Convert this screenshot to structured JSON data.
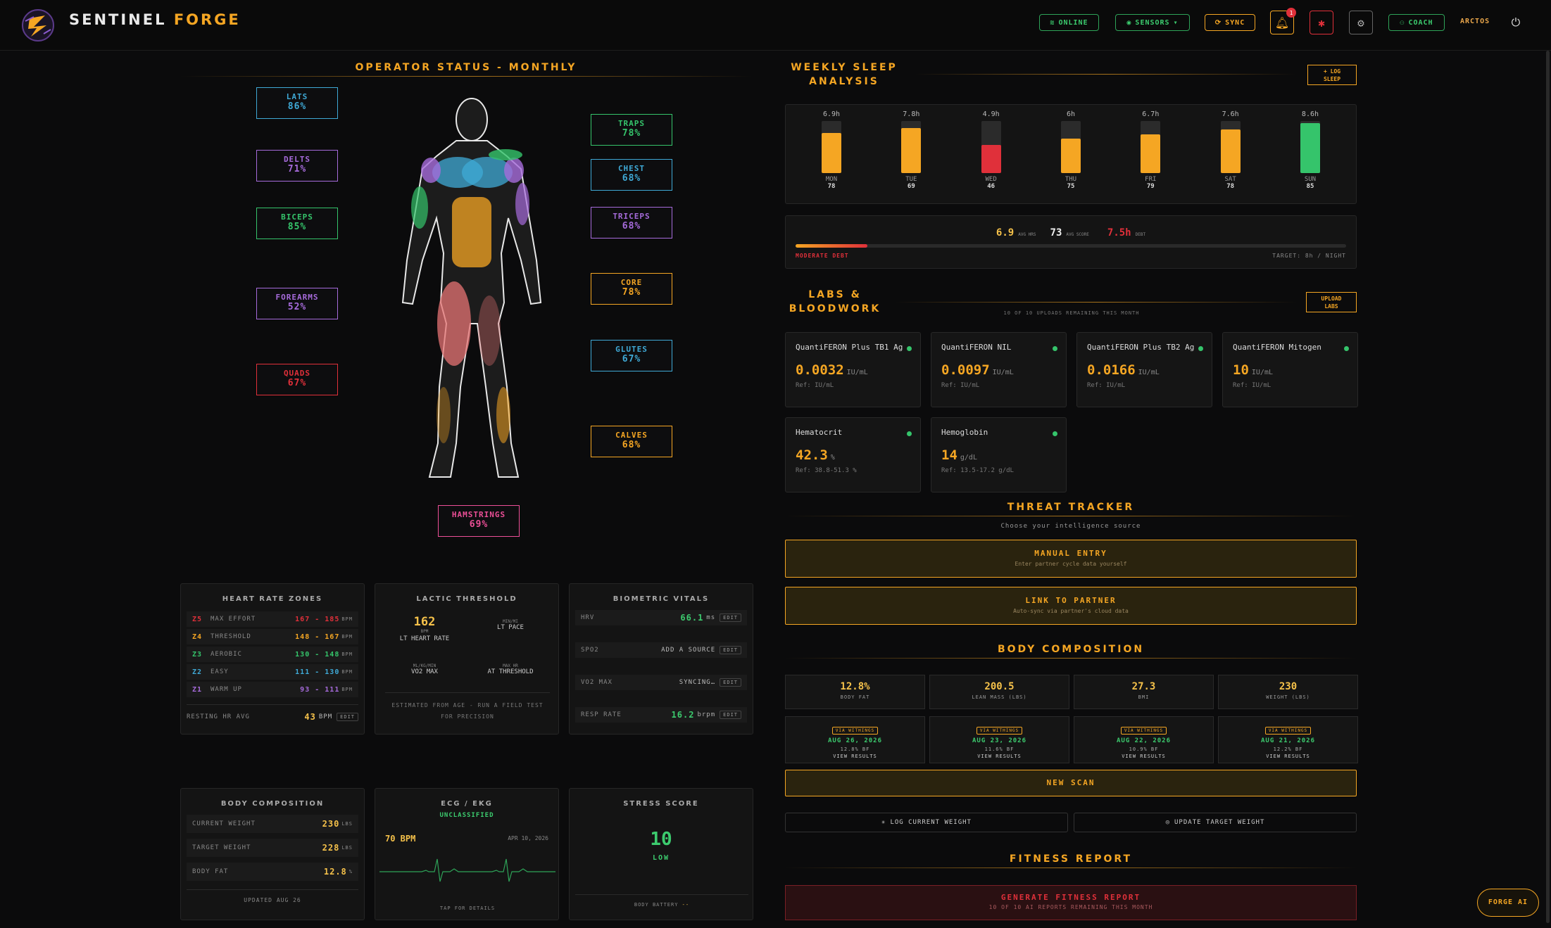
{
  "header": {
    "brand_main": "SENTINEL",
    "brand_accent": "FORGE",
    "online": "ONLINE",
    "sensors": "SENSORS",
    "sync": "SYNC",
    "notif_count": "1",
    "coach": "COACH",
    "user": "ARCTOS"
  },
  "operator": {
    "title": "OPERATOR STATUS - MONTHLY",
    "muscles": [
      {
        "name": "LATS",
        "pct": "86%",
        "color": "#3fa9d6"
      },
      {
        "name": "DELTS",
        "pct": "71%",
        "color": "#a66bdb"
      },
      {
        "name": "BICEPS",
        "pct": "85%",
        "color": "#35c46b"
      },
      {
        "name": "FOREARMS",
        "pct": "52%",
        "color": "#a66bdb"
      },
      {
        "name": "QUADS",
        "pct": "67%",
        "color": "#e0303a"
      },
      {
        "name": "TRAPS",
        "pct": "78%",
        "color": "#35c46b"
      },
      {
        "name": "CHEST",
        "pct": "68%",
        "color": "#3fa9d6"
      },
      {
        "name": "TRICEPS",
        "pct": "68%",
        "color": "#a66bdb"
      },
      {
        "name": "CORE",
        "pct": "78%",
        "color": "#f5a623"
      },
      {
        "name": "GLUTES",
        "pct": "67%",
        "color": "#3fa9d6"
      },
      {
        "name": "CALVES",
        "pct": "68%",
        "color": "#f5a623"
      },
      {
        "name": "HAMSTRINGS",
        "pct": "69%",
        "color": "#ec4f97"
      }
    ]
  },
  "hrz": {
    "title": "HEART RATE ZONES",
    "zones": [
      {
        "z": "Z5",
        "name": "MAX EFFORT",
        "range": "167 - 185",
        "unit": "BPM",
        "color": "#e0303a"
      },
      {
        "z": "Z4",
        "name": "THRESHOLD",
        "range": "148 - 167",
        "unit": "BPM",
        "color": "#f5a623"
      },
      {
        "z": "Z3",
        "name": "AEROBIC",
        "range": "130 - 148",
        "unit": "BPM",
        "color": "#35c46b"
      },
      {
        "z": "Z2",
        "name": "EASY",
        "range": "111 - 130",
        "unit": "BPM",
        "color": "#3fa9d6"
      },
      {
        "z": "Z1",
        "name": "WARM UP",
        "range": "93 - 111",
        "unit": "BPM",
        "color": "#a66bdb"
      }
    ],
    "resting_label": "RESTING HR AVG",
    "resting_val": "43",
    "resting_unit": "BPM",
    "edit": "EDIT"
  },
  "lactic": {
    "title": "LACTIC THRESHOLD",
    "hr": "162",
    "hr_unit": "BPM",
    "hr_label": "LT HEART RATE",
    "pace_unit": "MIN/MI",
    "pace_label": "LT PACE",
    "vo2_unit": "ML/KG/MIN",
    "vo2_label": "VO2 MAX",
    "maxhr_unit": "MAX HR",
    "maxhr_label": "AT THRESHOLD",
    "note": "ESTIMATED FROM AGE - RUN A FIELD TEST FOR PRECISION"
  },
  "bio": {
    "title": "BIOMETRIC VITALS",
    "rows": [
      {
        "k": "HRV",
        "v": "66.1",
        "u": "ms"
      },
      {
        "k": "SPO2",
        "v": "ADD A SOURCE",
        "u": ""
      },
      {
        "k": "VO2 MAX",
        "v": "SYNCING…",
        "u": ""
      },
      {
        "k": "RESP RATE",
        "v": "16.2",
        "u": "brpm"
      }
    ]
  },
  "bodycomp_left": {
    "title": "BODY COMPOSITION",
    "rows": [
      {
        "k": "CURRENT WEIGHT",
        "v": "230",
        "u": "LBS"
      },
      {
        "k": "TARGET WEIGHT",
        "v": "228",
        "u": "LBS"
      },
      {
        "k": "BODY FAT",
        "v": "12.8",
        "u": "%"
      }
    ],
    "updated": "UPDATED AUG 26"
  },
  "ecg": {
    "title": "ECG / EKG",
    "status": "UNCLASSIFIED",
    "bpm": "70 BPM",
    "date": "APR 10, 2026",
    "tap": "TAP FOR DETAILS"
  },
  "stress": {
    "title": "STRESS SCORE",
    "value": "10",
    "level": "LOW",
    "battery_label": "BODY BATTERY",
    "battery_val": "--"
  },
  "sleep": {
    "title_l1": "WEEKLY SLEEP",
    "title_l2": "ANALYSIS",
    "log_l1": "+ LOG",
    "log_l2": "SLEEP",
    "chart_data": {
      "type": "bar",
      "categories": [
        "MON",
        "TUE",
        "WED",
        "THU",
        "FRI",
        "SAT",
        "SUN"
      ],
      "values": [
        6.9,
        7.8,
        4.9,
        6,
        6.7,
        7.6,
        8.6
      ],
      "value_labels": [
        "6.9h",
        "7.8h",
        "4.9h",
        "6h",
        "6.7h",
        "7.6h",
        "8.6h"
      ],
      "scores": [
        "78",
        "69",
        "46",
        "75",
        "79",
        "78",
        "85"
      ],
      "colors": [
        "#f5a623",
        "#f5a623",
        "#e0303a",
        "#f5a623",
        "#f5a623",
        "#f5a623",
        "#35c46b"
      ],
      "ylim": [
        0,
        9
      ]
    },
    "avg_hrs": "6.9",
    "avg_hrs_label": "AVG HRS",
    "avg_score": "73",
    "avg_score_label": "AVG SCORE",
    "debt": "7.5h",
    "debt_label": "DEBT",
    "debt_status": "MODERATE DEBT",
    "target": "TARGET: 8h / NIGHT",
    "debt_fraction": 0.13
  },
  "labs": {
    "title_l1": "LABS &",
    "title_l2": "BLOODWORK",
    "remaining": "10 OF 10 UPLOADS REMAINING THIS MONTH",
    "upload_l1": "UPLOAD",
    "upload_l2": "LABS",
    "items": [
      {
        "n": "QuantiFERON Plus TB1 Ag",
        "v": "0.0032",
        "u": "IU/mL",
        "r": "Ref: IU/mL"
      },
      {
        "n": "QuantiFERON NIL",
        "v": "0.0097",
        "u": "IU/mL",
        "r": "Ref: IU/mL"
      },
      {
        "n": "QuantiFERON Plus TB2 Ag",
        "v": "0.0166",
        "u": "IU/mL",
        "r": "Ref: IU/mL"
      },
      {
        "n": "QuantiFERON Mitogen",
        "v": "10",
        "u": "IU/mL",
        "r": "Ref: IU/mL"
      },
      {
        "n": "Hematocrit",
        "v": "42.3",
        "u": "%",
        "r": "Ref: 38.8-51.3 %"
      },
      {
        "n": "Hemoglobin",
        "v": "14",
        "u": "g/dL",
        "r": "Ref: 13.5-17.2 g/dL"
      }
    ]
  },
  "threat": {
    "title": "THREAT TRACKER",
    "sub": "Choose your intelligence source",
    "manual": "MANUAL ENTRY",
    "manual_sub": "Enter partner cycle data yourself",
    "link": "LINK TO PARTNER",
    "link_sub": "Auto-sync via partner's cloud data"
  },
  "bodycomp": {
    "title": "BODY COMPOSITION",
    "stats": [
      {
        "v": "12.8%",
        "l": "BODY FAT"
      },
      {
        "v": "200.5",
        "l": "LEAN MASS (LBS)"
      },
      {
        "v": "27.3",
        "l": "BMI"
      },
      {
        "v": "230",
        "l": "WEIGHT (LBS)"
      }
    ],
    "scans": [
      {
        "tag": "VIA WITHINGS",
        "date": "AUG 26, 2026",
        "bf": "12.8% BF",
        "view": "VIEW RESULTS"
      },
      {
        "tag": "VIA WITHINGS",
        "date": "AUG 23, 2026",
        "bf": "11.6% BF",
        "view": "VIEW RESULTS"
      },
      {
        "tag": "VIA WITHINGS",
        "date": "AUG 22, 2026",
        "bf": "10.9% BF",
        "view": "VIEW RESULTS"
      },
      {
        "tag": "VIA WITHINGS",
        "date": "AUG 21, 2026",
        "bf": "12.2% BF",
        "view": "VIEW RESULTS"
      }
    ],
    "new_scan": "NEW SCAN",
    "log_weight": "LOG CURRENT WEIGHT",
    "update_target": "UPDATE TARGET WEIGHT"
  },
  "fitness": {
    "title": "FITNESS REPORT",
    "btn": "GENERATE FITNESS REPORT",
    "sub": "10 OF 10 AI REPORTS REMAINING THIS MONTH"
  },
  "forge_ai": "FORGE AI",
  "colors": {
    "accent": "#f5a623",
    "green": "#35c46b",
    "red": "#e0303a"
  }
}
